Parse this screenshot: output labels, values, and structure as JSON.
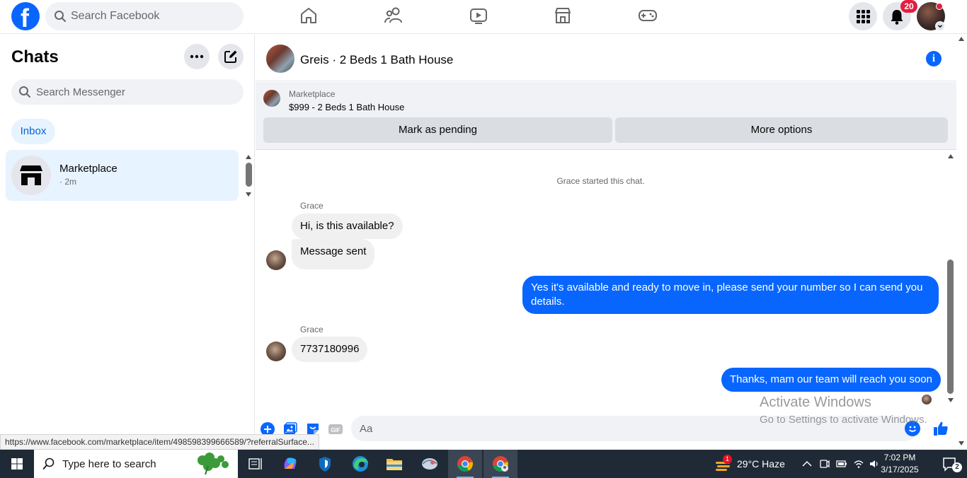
{
  "topbar": {
    "logo": "facebook-logo",
    "logo_letter": "f",
    "search_placeholder": "Search Facebook",
    "nav_icons": [
      "home-icon",
      "friends-icon",
      "video-icon",
      "marketplace-icon",
      "gaming-icon"
    ],
    "notification_count": "20"
  },
  "sidebar": {
    "title": "Chats",
    "search_placeholder": "Search Messenger",
    "filter_tab": "Inbox",
    "chats": [
      {
        "name": "Marketplace",
        "meta": "· 2m"
      }
    ]
  },
  "conversation": {
    "title": "Greis · 2 Beds 1 Bath House",
    "banner": {
      "label": "Marketplace",
      "listing": "$999 - 2 Beds 1 Bath House",
      "primary_button": "Mark as pending",
      "secondary_button": "More options"
    },
    "system_note": "Grace started this chat.",
    "messages": [
      {
        "sender": "Grace",
        "direction": "in",
        "texts": [
          "Hi, is this available?",
          "Message sent"
        ]
      },
      {
        "direction": "out",
        "text": "Yes it's available and ready to move in, please send your number so I can send you details."
      },
      {
        "sender": "Grace",
        "direction": "in",
        "texts": [
          "7737180996"
        ]
      },
      {
        "direction": "out",
        "text": "Thanks, mam our team will reach you soon"
      }
    ],
    "composer_placeholder": "Aa"
  },
  "watermark": {
    "title": "Activate Windows",
    "subtitle": "Go to Settings to activate Windows."
  },
  "status_url": "https://www.facebook.com/marketplace/item/498598399666589/?referralSurface...",
  "taskbar": {
    "search_placeholder": "Type here to search",
    "weather": "29°C  Haze",
    "weather_badge": "1",
    "time": "7:02 PM",
    "date": "3/17/2025",
    "notification_count": "2"
  },
  "colors": {
    "brand": "#0866ff",
    "outgoing_bubble": "#0866ff",
    "incoming_bubble": "#f0f0f0",
    "selected_chat": "#e7f3ff",
    "badge": "#e41e3f",
    "taskbar": "#1f2a36"
  }
}
